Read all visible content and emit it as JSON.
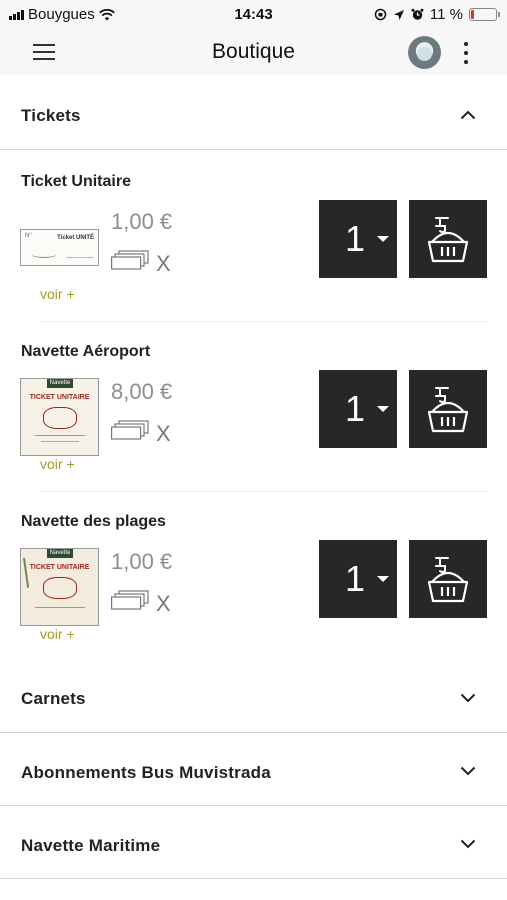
{
  "status_bar": {
    "carrier": "Bouygues",
    "time": "14:43",
    "battery_text": "11 %",
    "battery_level": 0.11,
    "battery_color": "#e23030"
  },
  "header": {
    "title": "Boutique",
    "menu_icon": "hamburger-icon",
    "profile_icon": "avatar",
    "more_icon": "kebab-icon"
  },
  "sections": {
    "tickets": {
      "label": "Tickets",
      "expanded": true,
      "products": [
        {
          "name": "Ticket Unitaire",
          "price": "1,00 €",
          "times": "X",
          "quantity": "1",
          "more_link": "voir +"
        },
        {
          "name": "Navette Aéroport",
          "price": "8,00 €",
          "times": "X",
          "quantity": "1",
          "more_link": "voir +"
        },
        {
          "name": "Navette des plages",
          "price": "1,00 €",
          "times": "X",
          "quantity": "1",
          "more_link": "voir +"
        }
      ]
    },
    "carnets": {
      "label": "Carnets",
      "expanded": false
    },
    "abonnements": {
      "label": "Abonnements Bus Muvistrada",
      "expanded": false
    },
    "navette_maritime": {
      "label": "Navette Maritime",
      "expanded": false
    }
  },
  "thumbnails": {
    "ticket_unitaire": {
      "top_left": "N°",
      "brand": "Ticket UNITÉ"
    },
    "navette_aeroport": {
      "top": "Navette",
      "title": "TICKET UNITAIRE"
    },
    "navette_plages": {
      "top": "Navette",
      "title": "TICKET UNITAIRE"
    }
  },
  "colors": {
    "button_bg": "#272727",
    "price": "#8e8e8e",
    "link": "#a59a1f",
    "divider": "#d6d6d6"
  }
}
